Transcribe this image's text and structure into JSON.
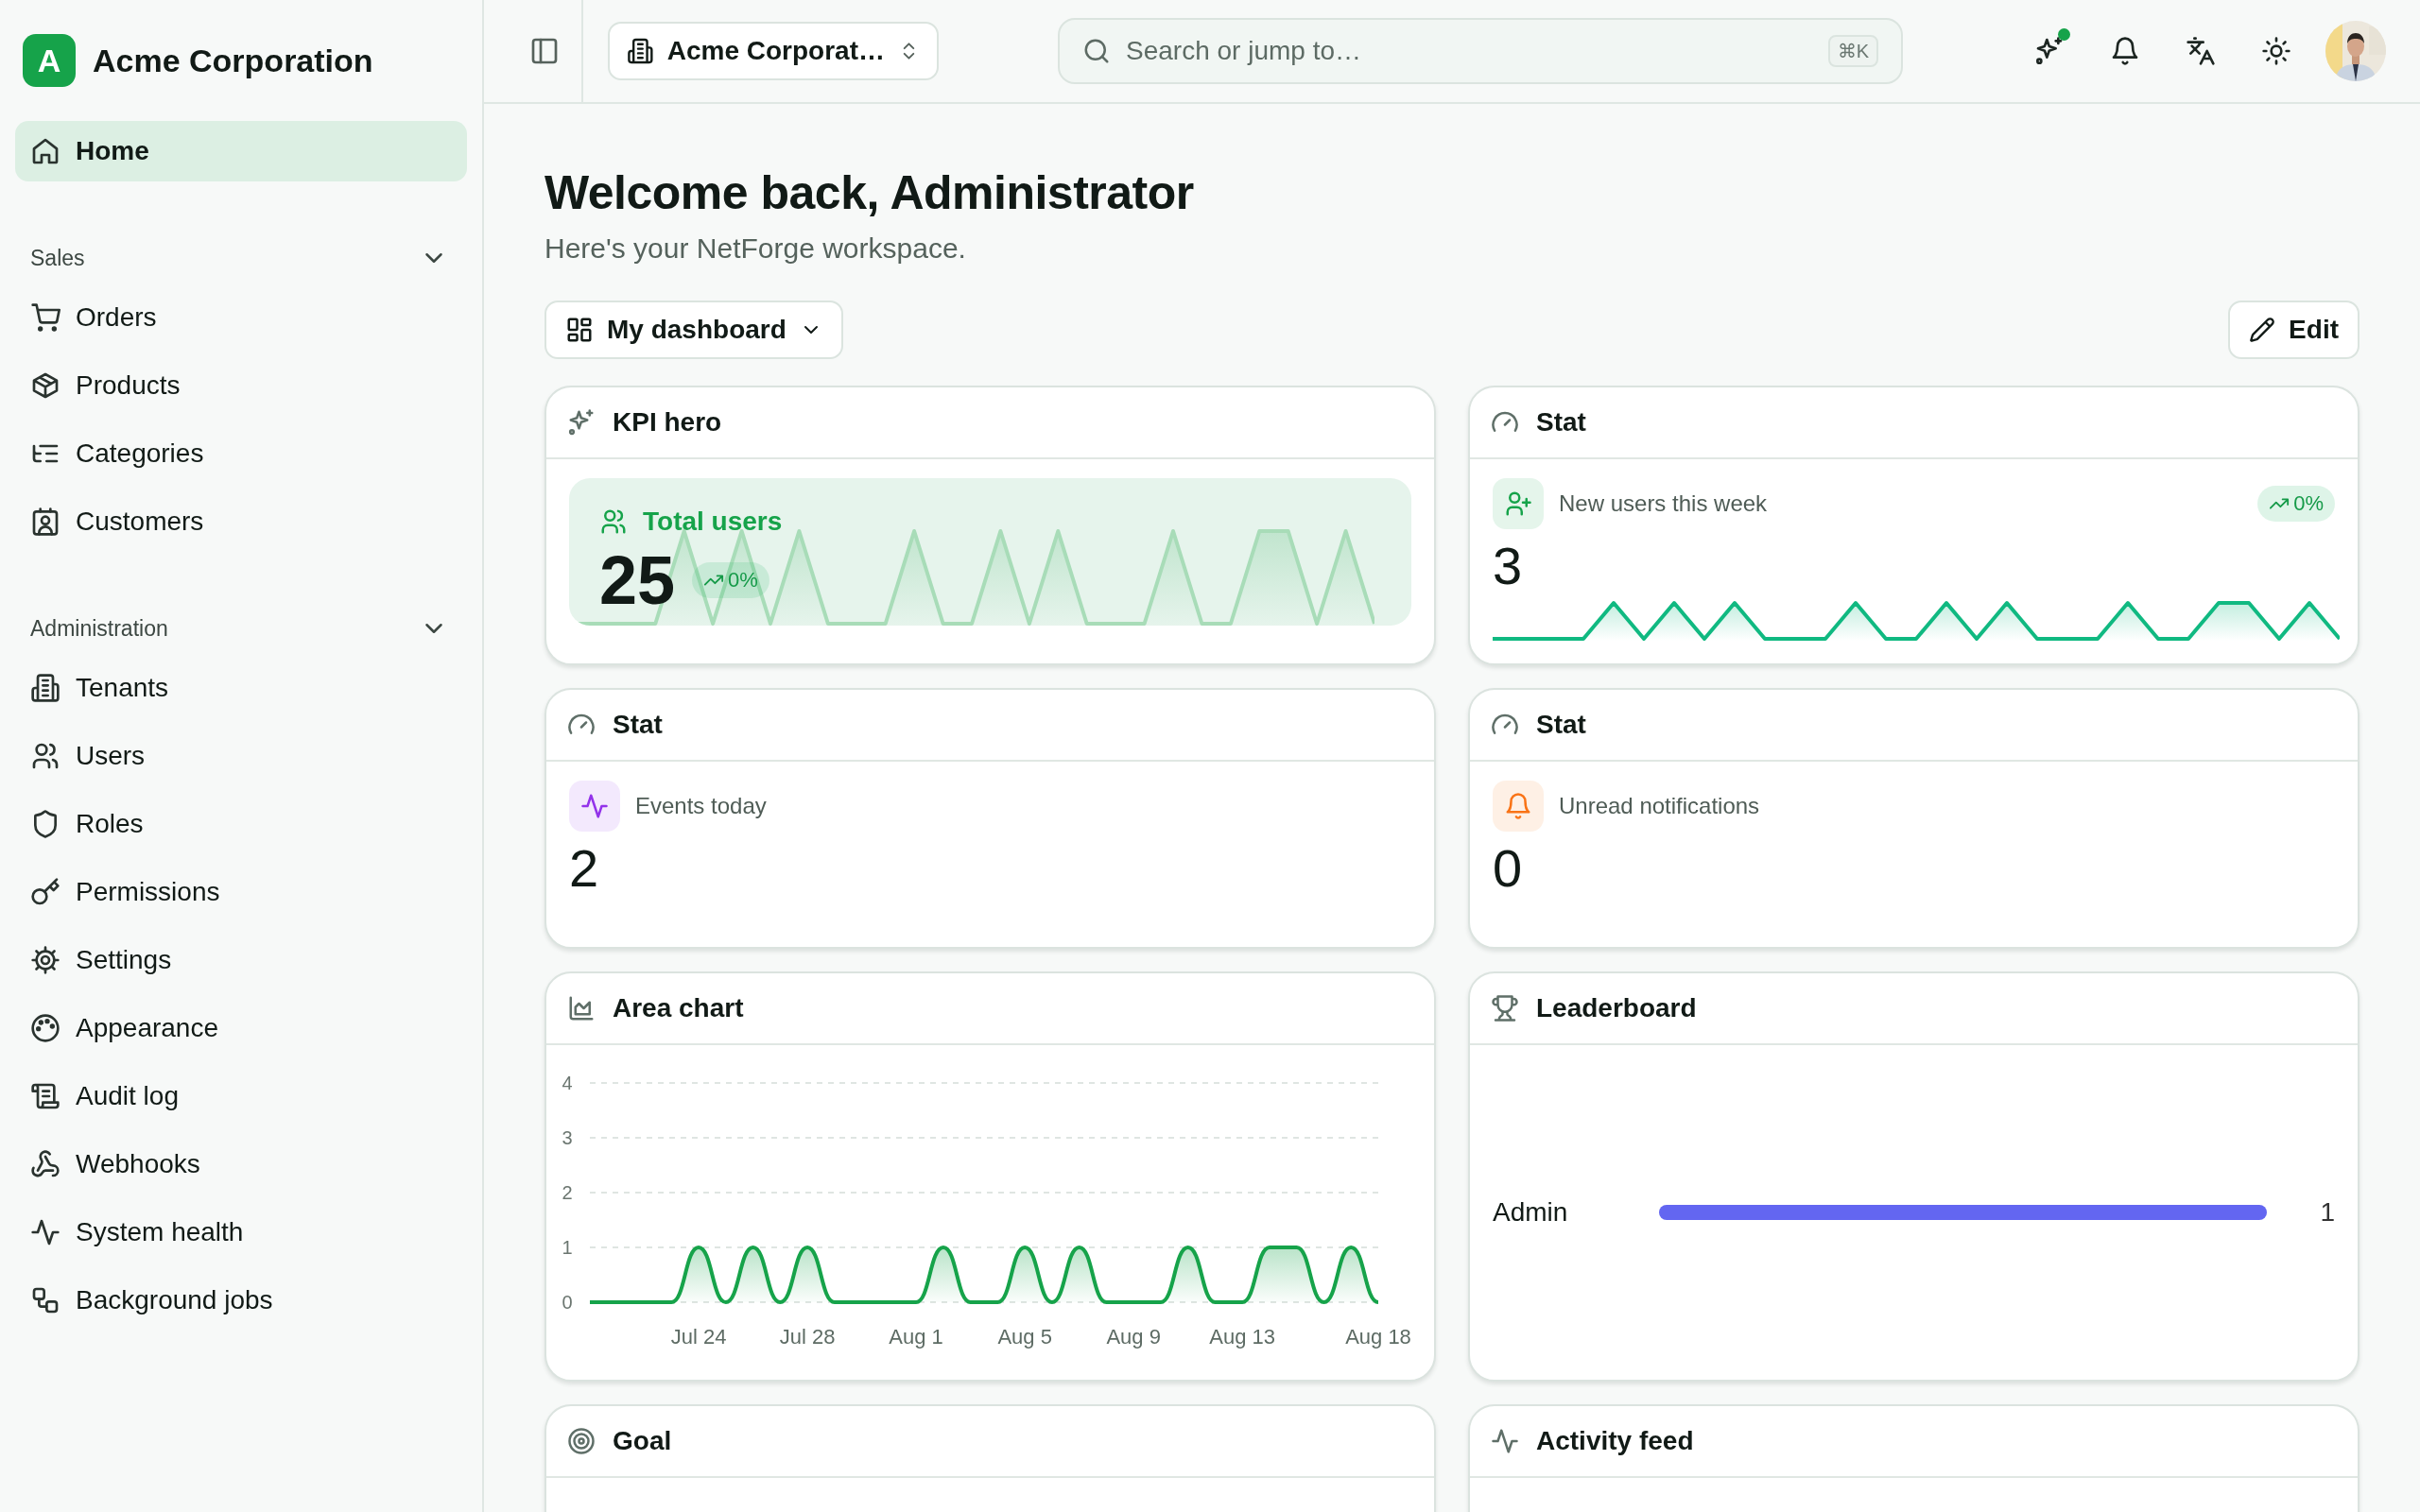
{
  "sidebar": {
    "brand": {
      "letter": "A",
      "name": "Acme Corporation"
    },
    "items": [
      {
        "label": "Home",
        "selected": true
      }
    ],
    "sections": [
      {
        "title": "Sales",
        "expanded": true,
        "items": [
          {
            "label": "Orders",
            "selected": false
          },
          {
            "label": "Products",
            "selected": false
          },
          {
            "label": "Categories",
            "selected": false
          },
          {
            "label": "Customers",
            "selected": false
          }
        ]
      },
      {
        "title": "Administration",
        "expanded": true,
        "items": [
          {
            "label": "Tenants",
            "selected": false
          },
          {
            "label": "Users",
            "selected": false
          },
          {
            "label": "Roles",
            "selected": false
          },
          {
            "label": "Permissions",
            "selected": false
          },
          {
            "label": "Settings",
            "selected": false
          },
          {
            "label": "Appearance",
            "selected": false
          },
          {
            "label": "Audit log",
            "selected": false
          },
          {
            "label": "Webhooks",
            "selected": false
          },
          {
            "label": "System health",
            "selected": false
          },
          {
            "label": "Background jobs",
            "selected": false
          }
        ]
      }
    ]
  },
  "topbar": {
    "organization": "Acme Corporat…",
    "search": {
      "placeholder": "Search or jump to…",
      "shortcut": "⌘K"
    },
    "assistant_unread": true
  },
  "main": {
    "title": "Welcome back, Administrator",
    "subtitle": "Here's your NetForge workspace.",
    "dashboard_select": "My dashboard",
    "edit_button": "Edit",
    "cards": [
      {
        "kind": "kpi_hero",
        "title": "KPI hero",
        "label": "Total users",
        "value": "25",
        "trend": "0%"
      },
      {
        "kind": "stat",
        "title": "Stat",
        "label": "New users this week",
        "value": "3",
        "trend": "0%",
        "color": "#16a34a",
        "sparkline": true
      },
      {
        "kind": "stat",
        "title": "Stat",
        "label": "Events today",
        "value": "2",
        "color": "#9333ea"
      },
      {
        "kind": "stat",
        "title": "Stat",
        "label": "Unread notifications",
        "value": "0",
        "color": "#f97316"
      },
      {
        "kind": "area_chart",
        "title": "Area chart",
        "chart_data": {
          "type": "area",
          "grid": true,
          "series": [
            {
              "color": "#16a34a",
              "values": [
                0,
                0,
                0,
                0,
                1,
                0,
                1,
                0,
                1,
                0,
                0,
                0,
                0,
                1,
                0,
                0,
                1,
                0,
                1,
                0,
                0,
                0,
                1,
                0,
                0,
                1,
                1,
                0,
                1,
                0
              ]
            }
          ],
          "categories": [
            null,
            null,
            null,
            null,
            "Jul 24",
            null,
            null,
            null,
            "Jul 28",
            null,
            null,
            null,
            "Aug 1",
            null,
            null,
            null,
            "Aug 5",
            null,
            null,
            null,
            "Aug 9",
            null,
            null,
            null,
            "Aug 13",
            null,
            null,
            null,
            null,
            "Aug 18"
          ],
          "ylim": [
            0,
            4
          ],
          "yticks": [
            0,
            1,
            2,
            3,
            4
          ]
        }
      },
      {
        "kind": "leaderboard",
        "title": "Leaderboard",
        "rows": [
          {
            "name": "Admin",
            "value": "1",
            "level": 1,
            "color": "#6366f1"
          }
        ]
      },
      {
        "kind": "goal",
        "title": "Goal"
      },
      {
        "kind": "activity",
        "title": "Activity feed"
      }
    ]
  }
}
